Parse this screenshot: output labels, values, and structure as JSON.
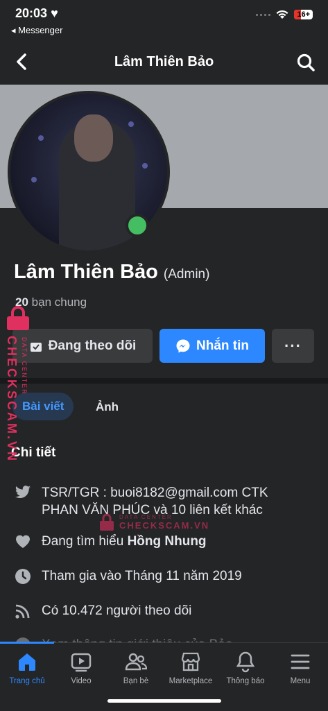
{
  "status_bar": {
    "time": "20:03",
    "back_app": "Messenger",
    "battery": "16+"
  },
  "header": {
    "title": "Lâm Thiên Bảo",
    "back_icon": "chevron-left-icon",
    "search_icon": "search-icon"
  },
  "profile": {
    "name": "Lâm Thiên Bảo",
    "role": "(Admin)",
    "mutual_count": "20",
    "mutual_label": "bạn chung",
    "online": true
  },
  "actions": {
    "follow_label": "Đang theo dõi",
    "message_label": "Nhắn tin",
    "more_label": "···"
  },
  "tabs": {
    "posts": "Bài viết",
    "photos": "Ảnh"
  },
  "details": {
    "title": "Chi tiết",
    "items": [
      {
        "icon": "twitter-icon",
        "text": "TSR/TGR : buoi8182@gmail.com CTK PHAN VĂN PHÚC và 10 liên kết khác"
      },
      {
        "icon": "heart-icon",
        "prefix": "Đang tìm hiểu ",
        "bold": "Hồng Nhung"
      },
      {
        "icon": "clock-icon",
        "text": "Tham gia vào Tháng 11 năm 2019"
      },
      {
        "icon": "rss-icon",
        "text": "Có 10.472 người theo dõi"
      },
      {
        "icon": "info-icon",
        "text": "Xem thông tin giới thiệu của Bảo"
      }
    ]
  },
  "watermark": {
    "main": "CHECKSCAM.VN",
    "sub": "DATA CENTER"
  },
  "bottom_nav": [
    {
      "label": "Trang chủ",
      "icon": "home-icon",
      "active": true
    },
    {
      "label": "Video",
      "icon": "video-icon",
      "active": false
    },
    {
      "label": "Bạn bè",
      "icon": "friends-icon",
      "active": false
    },
    {
      "label": "Marketplace",
      "icon": "marketplace-icon",
      "active": false
    },
    {
      "label": "Thông báo",
      "icon": "bell-icon",
      "active": false
    },
    {
      "label": "Menu",
      "icon": "menu-icon",
      "active": false
    }
  ],
  "colors": {
    "accent": "#2d88ff",
    "background": "#242526",
    "online": "#45bd62",
    "watermark": "#e03060"
  }
}
